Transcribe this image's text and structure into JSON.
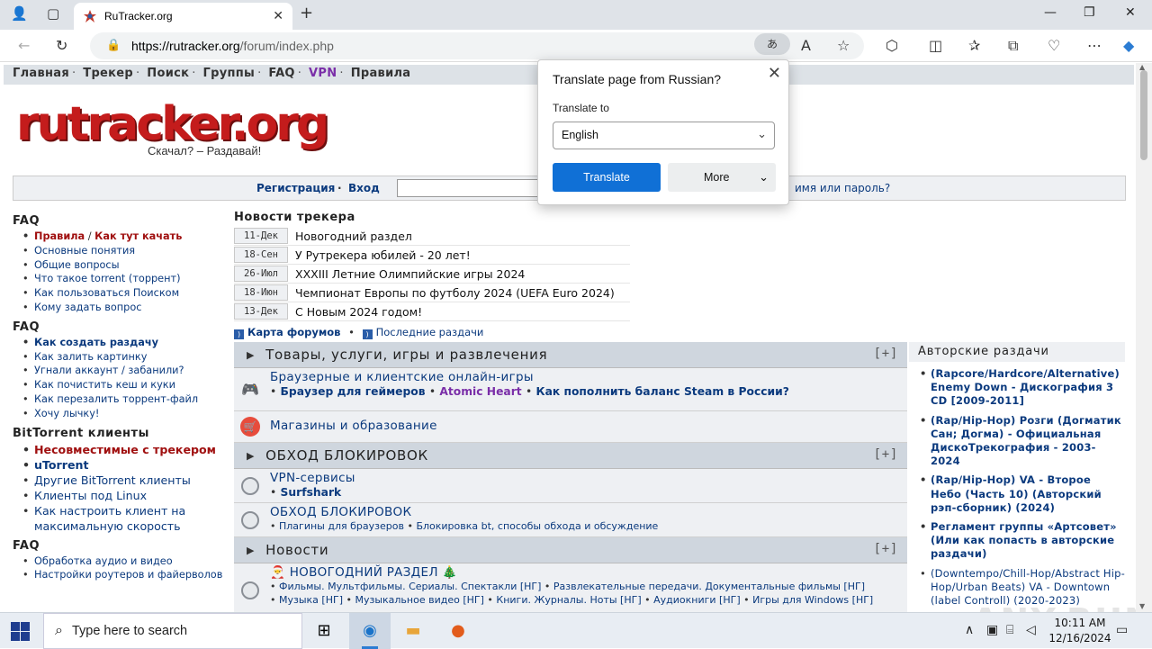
{
  "browser": {
    "tab_title": "RuTracker.org",
    "url_host": "https://rutracker.org",
    "url_path": "/forum/index.php",
    "translate_icon": "translate-icon"
  },
  "topnav": {
    "items": [
      "Главная",
      "Трекер",
      "Поиск",
      "Группы",
      "FAQ",
      "VPN",
      "Правила"
    ]
  },
  "logo": {
    "text": "rutracker.org",
    "tagline": "Скачал? – Раздавай!"
  },
  "login": {
    "register": "Регистрация",
    "dot": "·",
    "login": "Вход",
    "forgot": "имя или пароль?"
  },
  "sidebar": {
    "faq1_title": "FAQ",
    "faq1_rules": "Правила",
    "faq1_slash": " / ",
    "faq1_howto": "Как тут качать",
    "faq1_items": [
      "Основные понятия",
      "Общие вопросы",
      "Что такое torrent (торрент)",
      "Как пользоваться Поиском",
      "Кому задать вопрос"
    ],
    "faq2_title": "FAQ",
    "faq2_first": "Как создать раздачу",
    "faq2_items": [
      "Как залить картинку",
      "Угнали аккаунт / забанили?",
      "Как почистить кеш и куки",
      "Как перезалить торрент-файл",
      "Хочу лычку!"
    ],
    "bt_title": "BitTorrent клиенты",
    "bt_incompat": "Несовместимые с трекером",
    "bt_utorrent": "uTorrent",
    "bt_items": [
      "Другие BitTorrent клиенты",
      "Клиенты под Linux",
      "Как настроить клиент на максимальную скорость"
    ],
    "faq3_title": "FAQ",
    "faq3_items": [
      "Обработка аудио и видео",
      "Настройки роутеров и файерволов"
    ]
  },
  "news": {
    "title": "Новости трекера",
    "rows": [
      {
        "date": "11-Дек",
        "text": "Новогодний раздел"
      },
      {
        "date": "18-Сен",
        "text": "У Рутрекера юбилей - 20 лет!"
      },
      {
        "date": "26-Июл",
        "text": "XXXIII Летние Олимпийские игры 2024"
      },
      {
        "date": "18-Июн",
        "text": "Чемпионат Европы по футболу 2024 (UEFA Euro 2024)"
      },
      {
        "date": "13-Дек",
        "text": "С Новым 2024 годом!"
      }
    ]
  },
  "maplinks": {
    "forum_map": "Карта форумов",
    "dot": "•",
    "latest": "Последние раздачи"
  },
  "forums": {
    "cat1": "Товары, услуги, игры и развлечения",
    "plus": "[+]",
    "f1_name": "Браузерные и клиентские онлайн-игры",
    "f1_sub_a": "Браузер для геймеров",
    "f1_sub_b": "Atomic Heart",
    "f1_sub_c": "Как пополнить баланс",
    "f1_sub_d": "Steam",
    "f1_sub_e": "в России?",
    "f2_name": "Магазины и образование",
    "cat2": "ОБХОД БЛОКИРОВОК",
    "f3_name": "VPN-сервисы",
    "f3_sub": "Surfshark",
    "f4_name": "ОБХОД БЛОКИРОВОК",
    "f4_sub_a": "Плагины для браузеров",
    "f4_sub_b": "Блокировка bt, способы обхода и обсуждение",
    "cat3": "Новости",
    "f5_name": "НОВОГОДНИЙ РАЗДЕЛ",
    "f5_sub_1": "Фильмы. Мультфильмы. Сериалы. Спектакли [НГ]",
    "f5_sub_2": "Развлекательные передачи. Документальные фильмы [НГ]",
    "f5_sub_3": "Музыка [НГ]",
    "f5_sub_4": "Музыкальное видео [НГ]",
    "f5_sub_5": "Книги. Журналы. Ноты [НГ]",
    "f5_sub_6": "Аудиокниги [НГ]",
    "f5_sub_7": "Игры для Windows [НГ]"
  },
  "authors": {
    "title": "Авторские раздачи",
    "items": [
      "(Rapcore/Hardcore/Alternative) Enemy Down - Дискография 3 CD [2009-2011]",
      "(Rap/Hip-Hop) Розги (Догматик Сан; Догма) - Официальная ДискоТрекография - 2003-2024",
      "(Rap/Hip-Hop) VA - Второе Небо (Часть 10) (Авторский рэп-сборник) (2024)",
      "Регламент группы «Артсовет» (Или как попасть в авторские раздачи)",
      "(Downtempo/Chill-Hop/Abstract Hip-Hop/Urban Beats) VA - Downtown (label Controll) (2020-2023)"
    ]
  },
  "watermark": "ANY.RUN",
  "translate_popup": {
    "title": "Translate page from Russian?",
    "label": "Translate to",
    "selected": "English",
    "translate_btn": "Translate",
    "more_btn": "More"
  },
  "taskbar": {
    "search_placeholder": "Type here to search",
    "time": "10:11 AM",
    "date": "12/16/2024"
  }
}
